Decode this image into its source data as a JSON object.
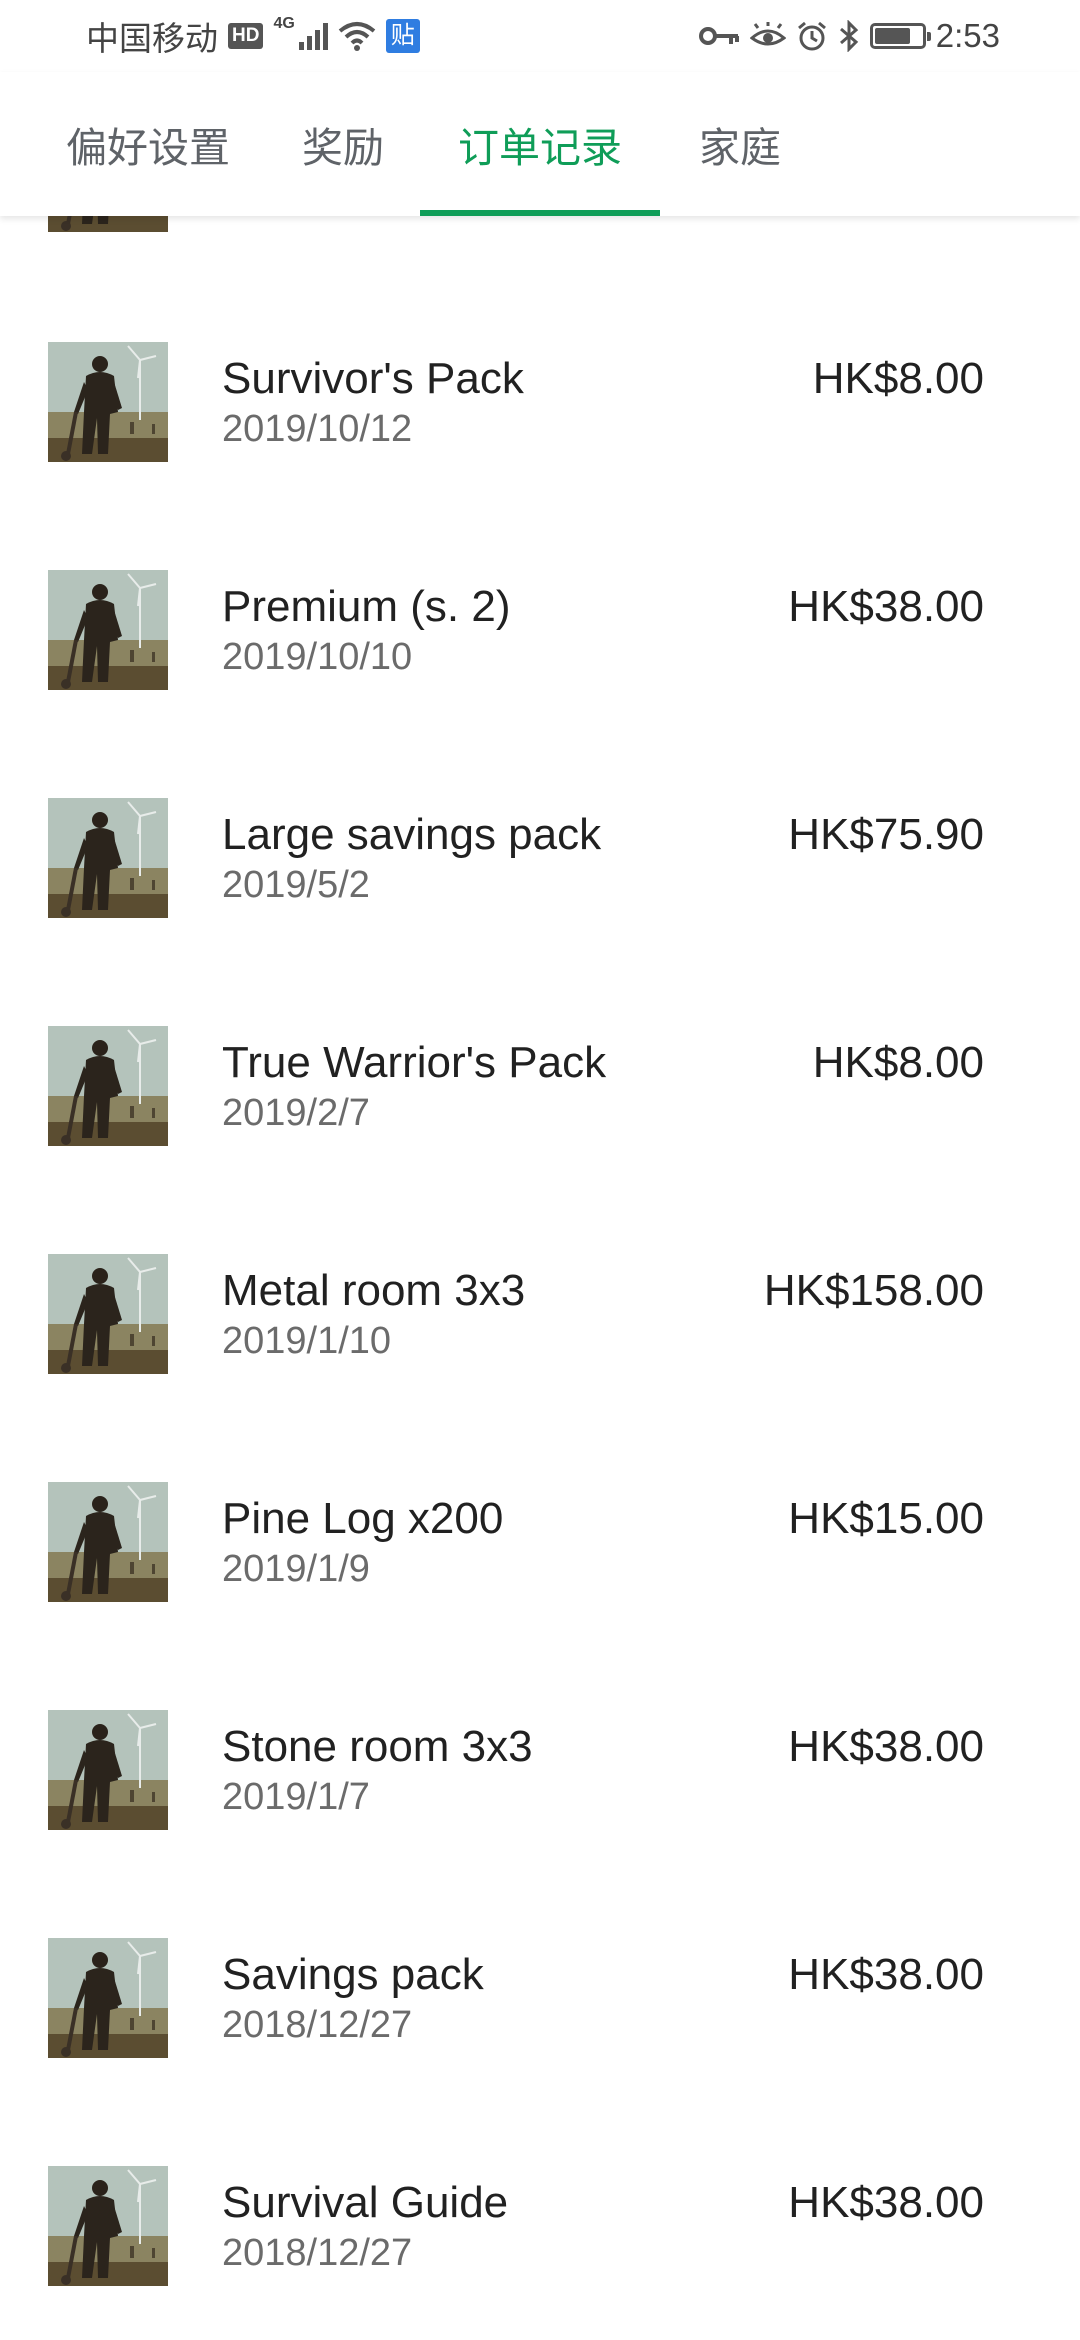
{
  "status_bar": {
    "carrier": "中国移动",
    "hd": "HD",
    "network": "4G",
    "tie_label": "贴",
    "time": "2:53",
    "battery_level": 0.75
  },
  "tabs": [
    {
      "label": "偏好设置",
      "active": false
    },
    {
      "label": "奖励",
      "active": false
    },
    {
      "label": "订单记录",
      "active": true
    },
    {
      "label": "家庭",
      "active": false
    }
  ],
  "colors": {
    "accent": "#0f9d58",
    "title_text": "#212121",
    "secondary_text": "#6b6b6b"
  },
  "orders": [
    {
      "title": "Survivor's Pack",
      "date": "2019/10/12",
      "price": "HK$8.00"
    },
    {
      "title": "Premium (s. 2)",
      "date": "2019/10/10",
      "price": "HK$38.00"
    },
    {
      "title": "Large savings pack",
      "date": "2019/5/2",
      "price": "HK$75.90"
    },
    {
      "title": "True Warrior's Pack",
      "date": "2019/2/7",
      "price": "HK$8.00"
    },
    {
      "title": "Metal room 3x3",
      "date": "2019/1/10",
      "price": "HK$158.00"
    },
    {
      "title": "Pine Log x200",
      "date": "2019/1/9",
      "price": "HK$15.00"
    },
    {
      "title": "Stone room 3x3",
      "date": "2019/1/7",
      "price": "HK$38.00"
    },
    {
      "title": "Savings pack",
      "date": "2018/12/27",
      "price": "HK$38.00"
    },
    {
      "title": "Survival Guide",
      "date": "2018/12/27",
      "price": "HK$38.00"
    }
  ]
}
